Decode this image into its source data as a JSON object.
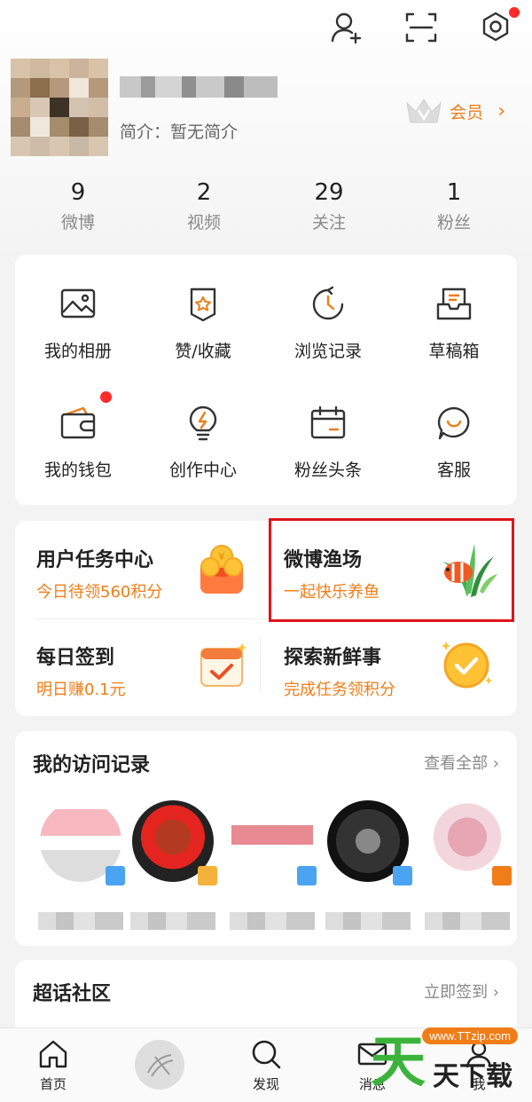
{
  "profile": {
    "bio": "简介：暂无简介",
    "vip_label": "会员",
    "vip_chevron": "›"
  },
  "stats": [
    {
      "num": "9",
      "label": "微博"
    },
    {
      "num": "2",
      "label": "视频"
    },
    {
      "num": "29",
      "label": "关注"
    },
    {
      "num": "1",
      "label": "粉丝"
    }
  ],
  "grid": [
    {
      "label": "我的相册",
      "icon": "photo-album-icon"
    },
    {
      "label": "赞/收藏",
      "icon": "favorite-icon"
    },
    {
      "label": "浏览记录",
      "icon": "history-icon"
    },
    {
      "label": "草稿箱",
      "icon": "drafts-icon"
    },
    {
      "label": "我的钱包",
      "icon": "wallet-icon"
    },
    {
      "label": "创作中心",
      "icon": "lightbulb-icon"
    },
    {
      "label": "粉丝头条",
      "icon": "calendar-icon"
    },
    {
      "label": "客服",
      "icon": "customer-service-icon"
    }
  ],
  "tasks": [
    {
      "title": "用户任务中心",
      "sub": "今日待领560积分"
    },
    {
      "title": "微博渔场",
      "sub": "一起快乐养鱼"
    },
    {
      "title": "每日签到",
      "sub": "明日赚0.1元"
    },
    {
      "title": "探索新鲜事",
      "sub": "完成任务领积分"
    }
  ],
  "visits": {
    "title": "我的访问记录",
    "more": "查看全部 ›"
  },
  "super_topic": {
    "title": "超话社区",
    "action": "立即签到 ›"
  },
  "bottom_nav": [
    {
      "label": "首页"
    },
    {
      "label": ""
    },
    {
      "label": "发现"
    },
    {
      "label": "消息"
    },
    {
      "label": "我"
    }
  ],
  "watermark": {
    "url": "www.TTzip.com",
    "big": "天",
    "small": "天下载"
  }
}
